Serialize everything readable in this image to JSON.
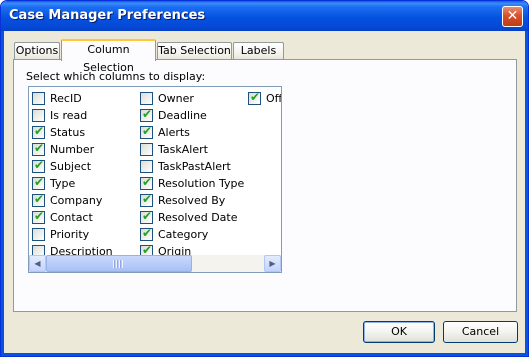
{
  "window": {
    "title": "Case Manager Preferences",
    "close_symbol": "✕"
  },
  "tabs": [
    {
      "label": "Options"
    },
    {
      "label": "Column Selection",
      "active": true
    },
    {
      "label": "Tab Selection"
    },
    {
      "label": "Labels"
    }
  ],
  "panel": {
    "instruction": "Select which columns to display:"
  },
  "columns": {
    "col1": [
      {
        "label": "RecID",
        "checked": false
      },
      {
        "label": "Is read",
        "checked": false
      },
      {
        "label": "Status",
        "checked": true
      },
      {
        "label": "Number",
        "checked": true
      },
      {
        "label": "Subject",
        "checked": true
      },
      {
        "label": "Type",
        "checked": true
      },
      {
        "label": "Company",
        "checked": true
      },
      {
        "label": "Contact",
        "checked": true
      },
      {
        "label": "Priority",
        "checked": false
      },
      {
        "label": "Description",
        "checked": false
      }
    ],
    "col2": [
      {
        "label": "Owner",
        "checked": false
      },
      {
        "label": "Deadline",
        "checked": true
      },
      {
        "label": "Alerts",
        "checked": true
      },
      {
        "label": "TaskAlert",
        "checked": false
      },
      {
        "label": "TaskPastAlert",
        "checked": false
      },
      {
        "label": "Resolution Type",
        "checked": true
      },
      {
        "label": "Resolved By",
        "checked": true
      },
      {
        "label": "Resolved Date",
        "checked": true
      },
      {
        "label": "Category",
        "checked": true
      },
      {
        "label": "Origin",
        "checked": true
      }
    ],
    "col3": [
      {
        "label": "Off",
        "checked": true
      }
    ]
  },
  "scrollbar": {
    "left_arrow": "◀",
    "right_arrow": "▶"
  },
  "buttons": {
    "ok": "OK",
    "cancel": "Cancel"
  },
  "colors": {
    "titlebar": "#0553de",
    "dialog_bg": "#ece9d8",
    "active_tab_accent": "#ffc83c",
    "check": "#21a121"
  }
}
